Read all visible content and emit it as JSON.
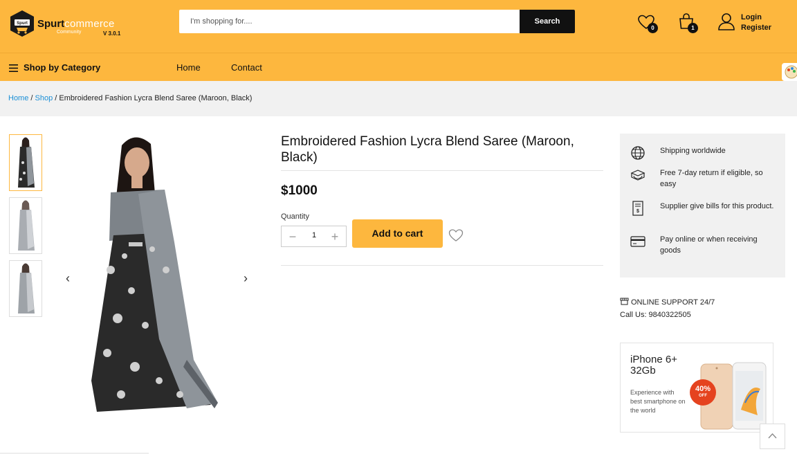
{
  "header": {
    "logo_brand_bold": "Spurt",
    "logo_brand_light": "commerce",
    "logo_sub": "Community",
    "logo_version": "V 3.0.1",
    "search_placeholder": "I'm shopping for....",
    "search_button": "Search",
    "wishlist_count": "0",
    "cart_count": "1",
    "login": "Login",
    "register": "Register"
  },
  "nav": {
    "category_label": "Shop by Category",
    "links": [
      "Home",
      "Contact"
    ]
  },
  "breadcrumb": {
    "home": "Home",
    "shop": "Shop",
    "current": "Embroidered Fashion Lycra Blend Saree (Maroon, Black)"
  },
  "product": {
    "title": "Embroidered Fashion Lycra Blend Saree (Maroon, Black)",
    "price": "$1000",
    "quantity_label": "Quantity",
    "quantity_value": "1",
    "add_to_cart": "Add to cart"
  },
  "info": [
    {
      "icon": "globe-icon",
      "text": "Shipping worldwide"
    },
    {
      "icon": "return-box-icon",
      "text": "Free 7-day return if eligible, so easy"
    },
    {
      "icon": "bill-icon",
      "text": "Supplier give bills for this product."
    },
    {
      "icon": "card-icon",
      "text": "Pay online or when receiving goods"
    }
  ],
  "support": {
    "heading": "ONLINE SUPPORT 24/7",
    "call": "Call Us: 9840322505"
  },
  "promo": {
    "title": "iPhone 6+ 32Gb",
    "subtitle": "Experience with best smartphone on the world",
    "badge_pct": "40%",
    "badge_off": "OFF"
  },
  "colors": {
    "accent": "#fdb73e",
    "link": "#1b8fd6",
    "dark": "#111111"
  }
}
